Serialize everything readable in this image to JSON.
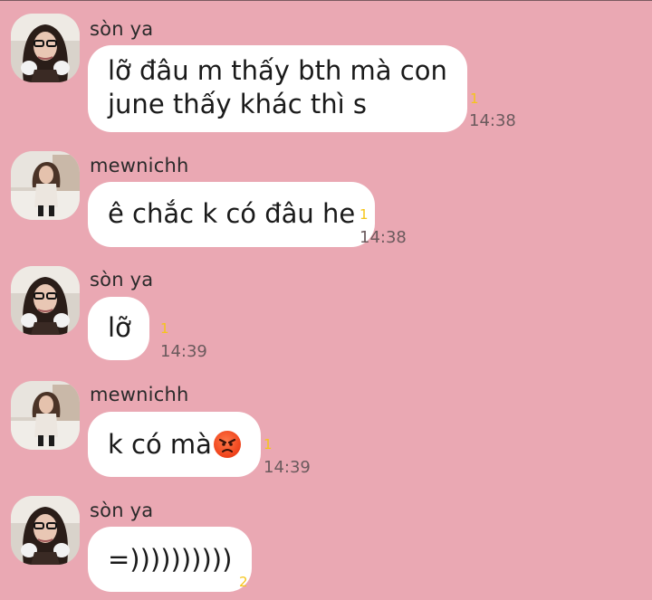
{
  "messages": [
    {
      "sender": "sòn ya",
      "lines": [
        "lỡ đâu m thấy bth mà con",
        "june thấy khác thì s"
      ],
      "read_count": "1",
      "time": "14:38"
    },
    {
      "sender": "mewnichh",
      "text": "ê chắc k có đâu he",
      "read_count": "1",
      "time": "14:38"
    },
    {
      "sender": "sòn ya",
      "text": "lỡ",
      "read_count": "1",
      "time": "14:39"
    },
    {
      "sender": "mewnichh",
      "text": "k có mà",
      "emoji": "angry-face",
      "read_count": "1",
      "time": "14:39"
    },
    {
      "sender": "sòn ya",
      "text": "=))))))))))",
      "read_count": "2",
      "time": ""
    }
  ],
  "colors": {
    "background": "#eaa8b3",
    "bubble": "#ffffff",
    "read_count": "#f5c518",
    "time": "#6b5a5d"
  }
}
